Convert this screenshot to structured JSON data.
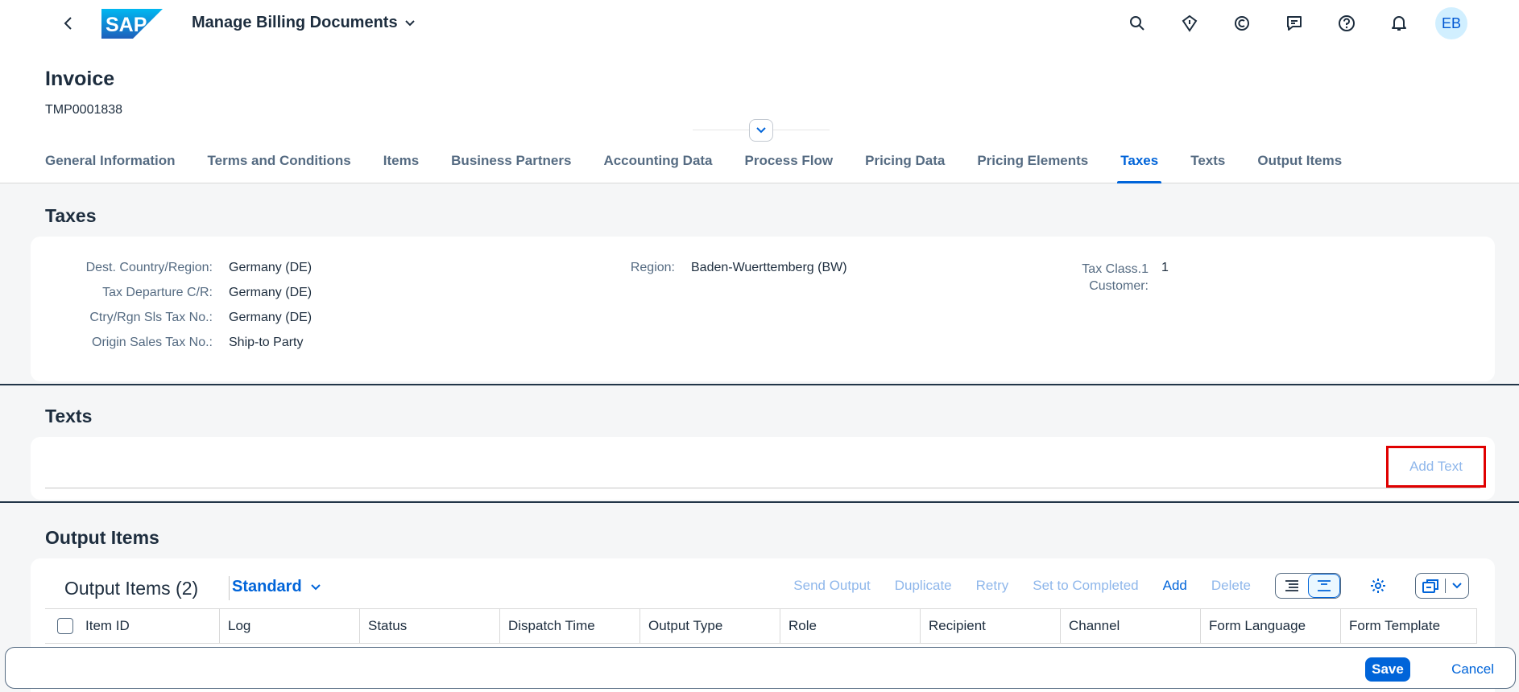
{
  "shell": {
    "app_title": "Manage Billing Documents",
    "logo_text": "SAP",
    "avatar_initials": "EB",
    "icons": [
      "search-icon",
      "joule-icon",
      "copilot-icon",
      "feedback-icon",
      "help-icon",
      "notifications-icon"
    ]
  },
  "header": {
    "title": "Invoice",
    "subtitle": "TMP0001838"
  },
  "tabs": [
    {
      "label": "General Information"
    },
    {
      "label": "Terms and Conditions"
    },
    {
      "label": "Items"
    },
    {
      "label": "Business Partners"
    },
    {
      "label": "Accounting Data"
    },
    {
      "label": "Process Flow"
    },
    {
      "label": "Pricing Data"
    },
    {
      "label": "Pricing Elements"
    },
    {
      "label": "Taxes",
      "active": true
    },
    {
      "label": "Texts"
    },
    {
      "label": "Output Items"
    }
  ],
  "taxes": {
    "title": "Taxes",
    "fields": [
      {
        "label": "Dest. Country/Region:",
        "value": "Germany (DE)"
      },
      {
        "label": "Tax Departure C/R:",
        "value": "Germany (DE)"
      },
      {
        "label": "Ctry/Rgn Sls Tax No.:",
        "value": "Germany (DE)"
      },
      {
        "label": "Origin Sales Tax No.:",
        "value": "Ship-to Party"
      },
      {
        "label": "Region:",
        "value": "Baden-Wuerttemberg (BW)"
      },
      {
        "label_line1": "Tax Class.1",
        "label_line2": "Customer:",
        "value": "1"
      }
    ]
  },
  "texts": {
    "title": "Texts",
    "add_text_label": "Add Text"
  },
  "output_items": {
    "section_title": "Output Items",
    "table_title": "Output Items (2)",
    "variant": "Standard",
    "actions": {
      "send_output": "Send Output",
      "duplicate": "Duplicate",
      "retry": "Retry",
      "set_to_completed": "Set to Completed",
      "add": "Add",
      "delete": "Delete"
    },
    "columns": [
      "Item ID",
      "Log",
      "Status",
      "Dispatch Time",
      "Output Type",
      "Role",
      "Recipient",
      "Channel",
      "Form Language",
      "Form Template"
    ]
  },
  "footer": {
    "save_label": "Save",
    "cancel_label": "Cancel"
  }
}
